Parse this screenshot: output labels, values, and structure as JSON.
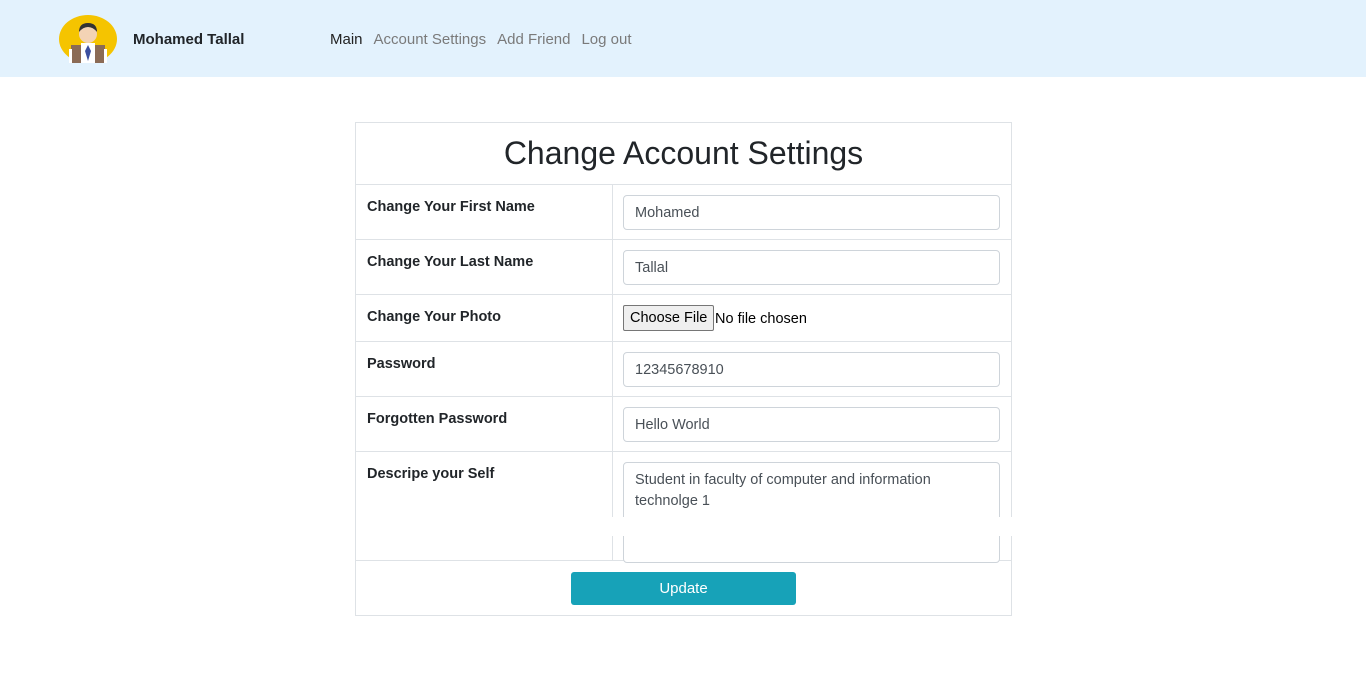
{
  "navbar": {
    "user_name": "Mohamed Tallal",
    "links": [
      {
        "label": "Main"
      },
      {
        "label": "Account Settings"
      },
      {
        "label": "Add Friend"
      },
      {
        "label": "Log out"
      }
    ]
  },
  "form": {
    "title": "Change Account Settings",
    "first_name": {
      "label": "Change Your First Name",
      "value": "Mohamed"
    },
    "last_name": {
      "label": "Change Your Last Name",
      "value": "Tallal"
    },
    "photo": {
      "label": "Change Your Photo",
      "button": "Choose File",
      "status": "No file chosen"
    },
    "password": {
      "label": "Password",
      "value": "12345678910"
    },
    "forgotten_password": {
      "label": "Forgotten Password",
      "value": "Hello World"
    },
    "describe": {
      "label": "Descripe your Self",
      "value": "Student in faculty of computer and information technolge 1"
    },
    "submit_label": "Update"
  },
  "colors": {
    "navbar_bg": "#e3f2fd",
    "button_bg": "#17a2b8"
  }
}
